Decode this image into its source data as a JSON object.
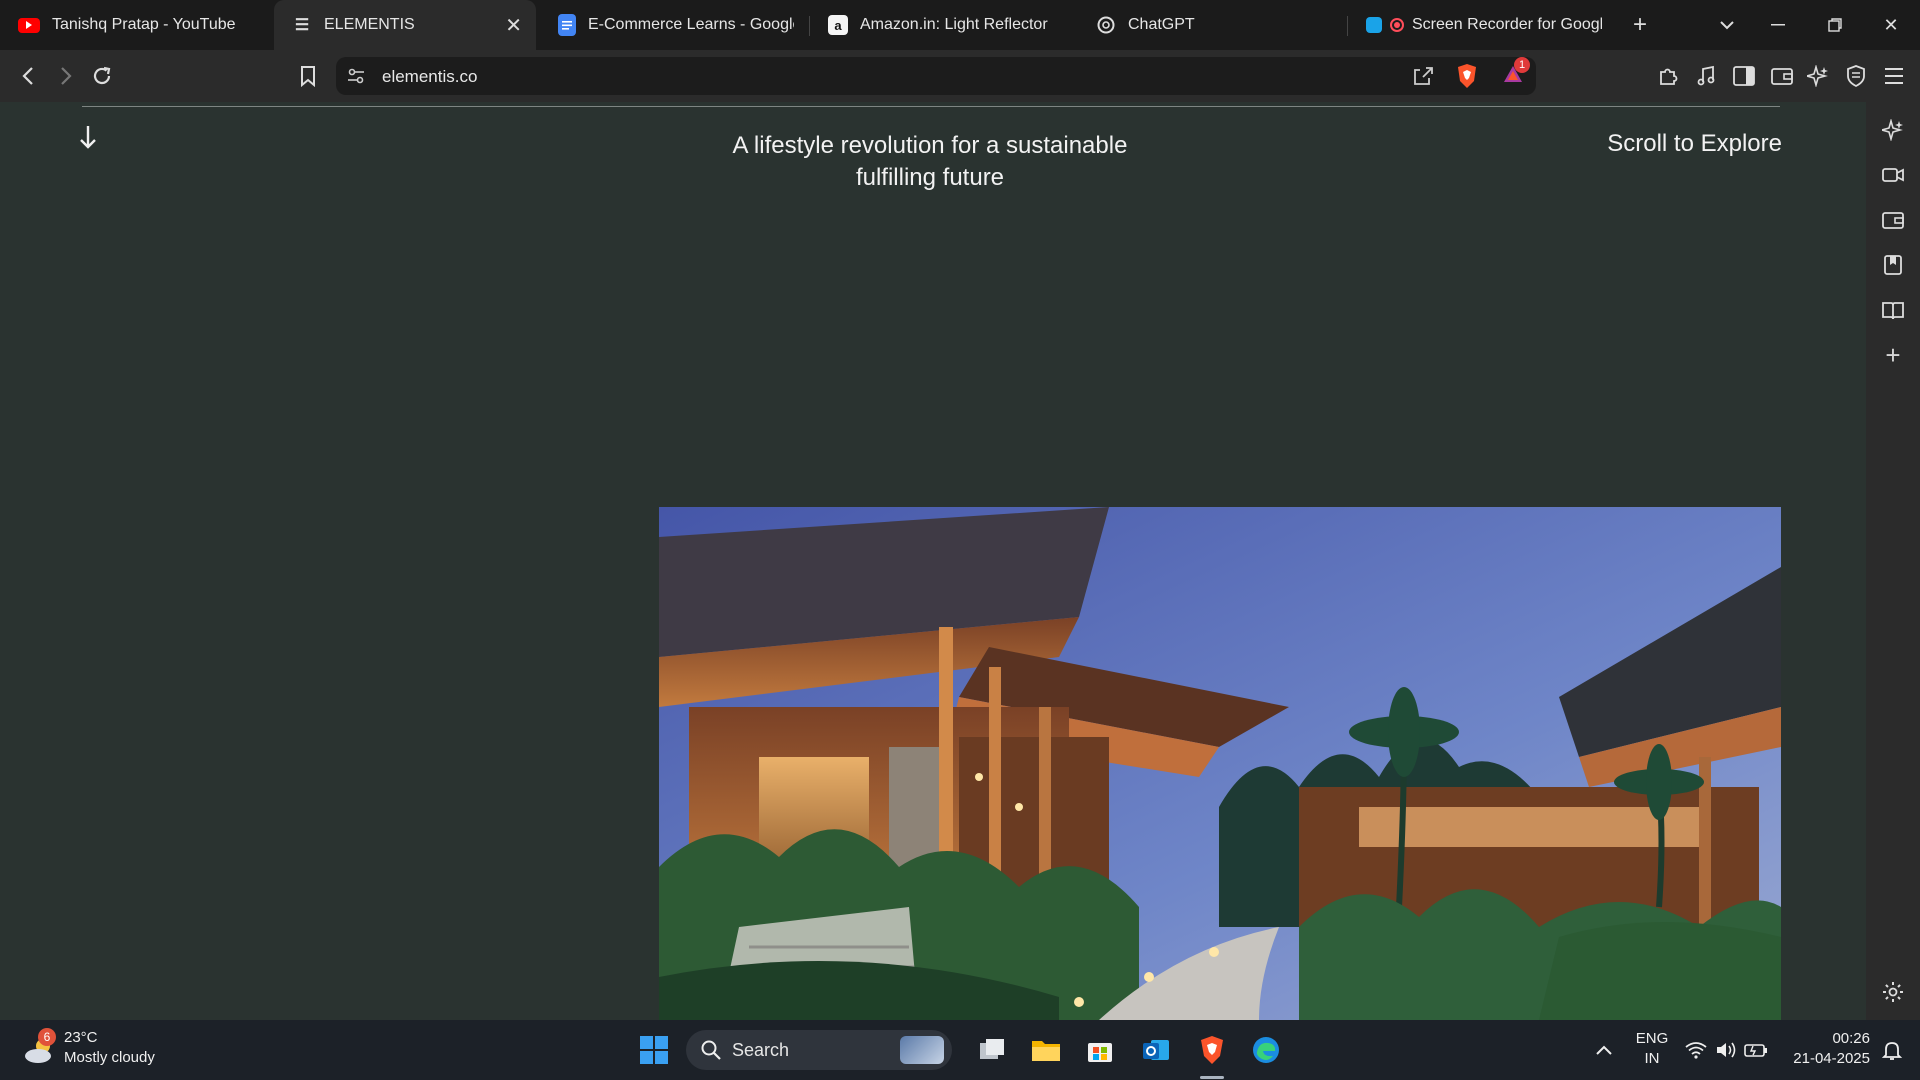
{
  "tabs": [
    {
      "title": "Tanishq Pratap - YouTube",
      "favicon": "youtube-icon"
    },
    {
      "title": "ELEMENTIS",
      "favicon": "menu-icon",
      "active": true
    },
    {
      "title": "E-Commerce Learns - Google D",
      "favicon": "google-docs-icon"
    },
    {
      "title": "Amazon.in: Light Reflector",
      "favicon": "amazon-icon"
    },
    {
      "title": "ChatGPT",
      "favicon": "chatgpt-icon"
    },
    {
      "title": "Screen Recorder for Google",
      "favicon": "screen-recorder-icon"
    }
  ],
  "toolbar": {
    "url": "elementis.co",
    "brave_rewards_badge": "1"
  },
  "page": {
    "hero_text": "A lifestyle revolution for a sustainable fulfilling future",
    "scroll_label": "Scroll to Explore",
    "background_color": "#2a3330"
  },
  "taskbar": {
    "weather_temp": "23°C",
    "weather_desc": "Mostly cloudy",
    "weather_badge": "6",
    "search_label": "Search",
    "lang_line1": "ENG",
    "lang_line2": "IN",
    "time": "00:26",
    "date": "21-04-2025"
  },
  "colors": {
    "tab_strip": "#1b1b1b",
    "toolbar": "#2b2b2b",
    "brave_orange": "#fb542b",
    "taskbar": "#1c2128"
  }
}
